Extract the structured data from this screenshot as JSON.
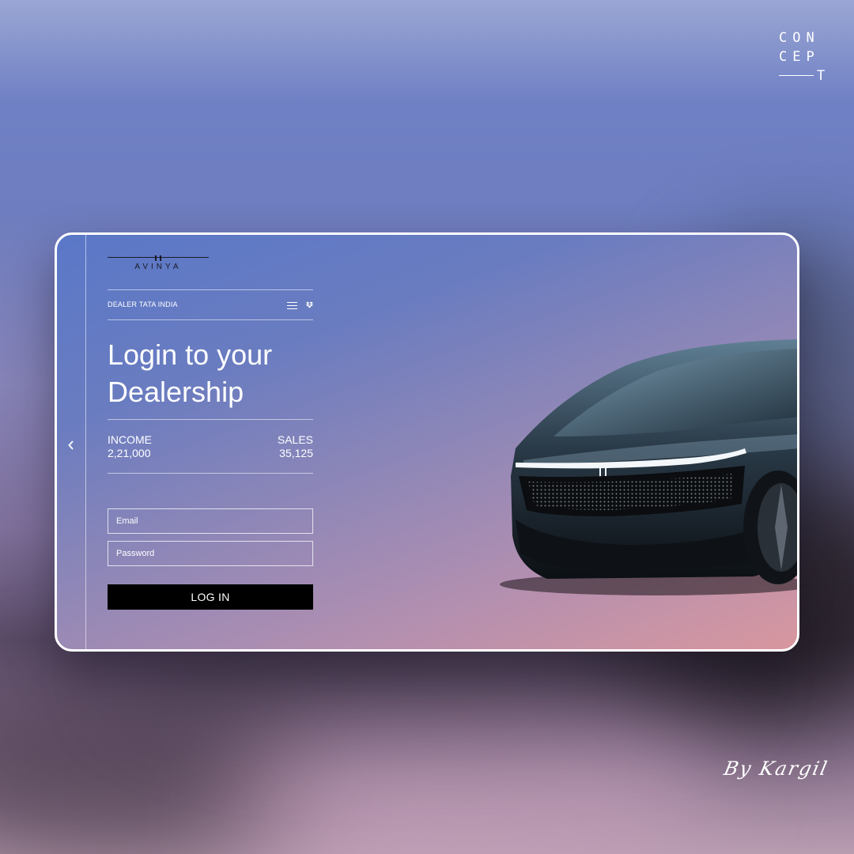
{
  "brand": {
    "concept_rows": [
      "CON",
      "CEP"
    ],
    "concept_last": "T",
    "signature": "By Kargil"
  },
  "app": {
    "logo_text": "AVINYA",
    "header_label": "DEALER TATA INDIA",
    "title_lines": [
      "Login to your",
      "Dealership"
    ],
    "stats": {
      "income": {
        "label": "INCOME",
        "value": "2,21,000"
      },
      "sales": {
        "label": "SALES",
        "value": "35,125"
      }
    },
    "form": {
      "email_placeholder": "Email",
      "password_placeholder": "Password",
      "login_label": "LOG IN"
    }
  },
  "icons": {
    "back": "chevron-left-icon",
    "menu": "hamburger-menu-icon",
    "dropbox": "dropbox-icon"
  },
  "colors": {
    "card_top": "#5a78c8",
    "card_bottom": "#d8979f",
    "button": "#000000",
    "text": "#ffffff"
  }
}
